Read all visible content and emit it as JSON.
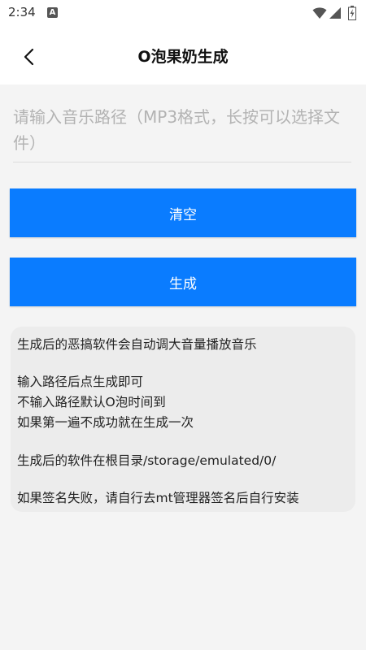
{
  "status_bar": {
    "time": "2:34",
    "notification_icon": "A",
    "icons": [
      "wifi-icon",
      "signal-icon",
      "battery-icon"
    ]
  },
  "app_bar": {
    "title": "O泡果奶生成",
    "back_icon": "chevron-left-icon"
  },
  "path_input": {
    "value": "",
    "placeholder": "请输入音乐路径（MP3格式，长按可以选择文件）"
  },
  "buttons": {
    "clear_label": "清空",
    "generate_label": "生成"
  },
  "info": {
    "line1": "生成后的恶搞软件会自动调大音量播放音乐",
    "line2": "输入路径后点生成即可",
    "line3": "不输入路径默认O泡时间到",
    "line4": "如果第一遍不成功就在生成一次",
    "line5": "生成后的软件在根目录/storage/emulated/0/",
    "line6": "如果签名失败，请自行去mt管理器签名后自行安装"
  },
  "colors": {
    "primary": "#0a7cff",
    "background": "#f4f4f4",
    "card": "#ececec"
  }
}
